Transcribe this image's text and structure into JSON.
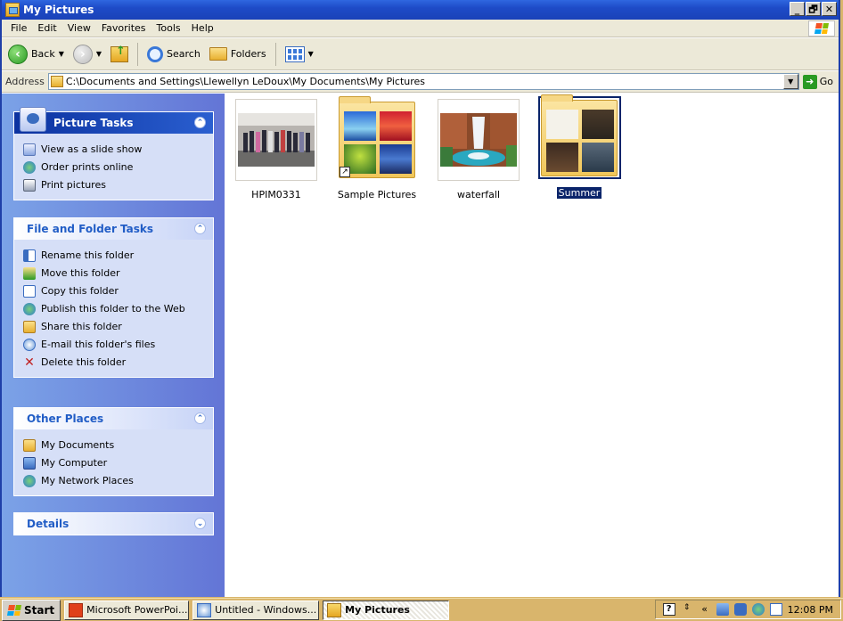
{
  "window": {
    "title": "My Pictures"
  },
  "window_buttons": [
    "_",
    "🗗",
    "✕"
  ],
  "menu": [
    "File",
    "Edit",
    "View",
    "Favorites",
    "Tools",
    "Help"
  ],
  "toolbar": {
    "back": "Back",
    "search": "Search",
    "folders": "Folders"
  },
  "address": {
    "label": "Address",
    "value": "C:\\Documents and Settings\\Llewellyn LeDoux\\My Documents\\My Pictures",
    "go": "Go"
  },
  "panels": {
    "picture_tasks": {
      "title": "Picture Tasks",
      "items": [
        "View as a slide show",
        "Order prints online",
        "Print pictures"
      ]
    },
    "file_folder_tasks": {
      "title": "File and Folder Tasks",
      "items": [
        "Rename this folder",
        "Move this folder",
        "Copy this folder",
        "Publish this folder to the Web",
        "Share this folder",
        "E-mail this folder's files",
        "Delete this folder"
      ]
    },
    "other_places": {
      "title": "Other Places",
      "items": [
        "My Documents",
        "My Computer",
        "My Network Places"
      ]
    },
    "details": {
      "title": "Details"
    }
  },
  "files": [
    {
      "name": "HPIM0331",
      "kind": "photo",
      "selected": false
    },
    {
      "name": "Sample Pictures",
      "kind": "folder",
      "shortcut": true,
      "selected": false
    },
    {
      "name": "waterfall",
      "kind": "photo",
      "selected": false
    },
    {
      "name": "Summer",
      "kind": "folder",
      "selected": true
    }
  ],
  "taskbar": {
    "start": "Start",
    "buttons": [
      "Microsoft PowerPoi...",
      "Untitled - Windows...",
      "My Pictures"
    ],
    "active_button": "My Pictures",
    "clock": "12:08 PM"
  },
  "colors": {
    "title_bar": "#1e4bc7",
    "left_pane": "#6375d6",
    "panel_body": "#d6dff7",
    "selection": "#0a246a",
    "taskbar": "#d9b56c"
  }
}
